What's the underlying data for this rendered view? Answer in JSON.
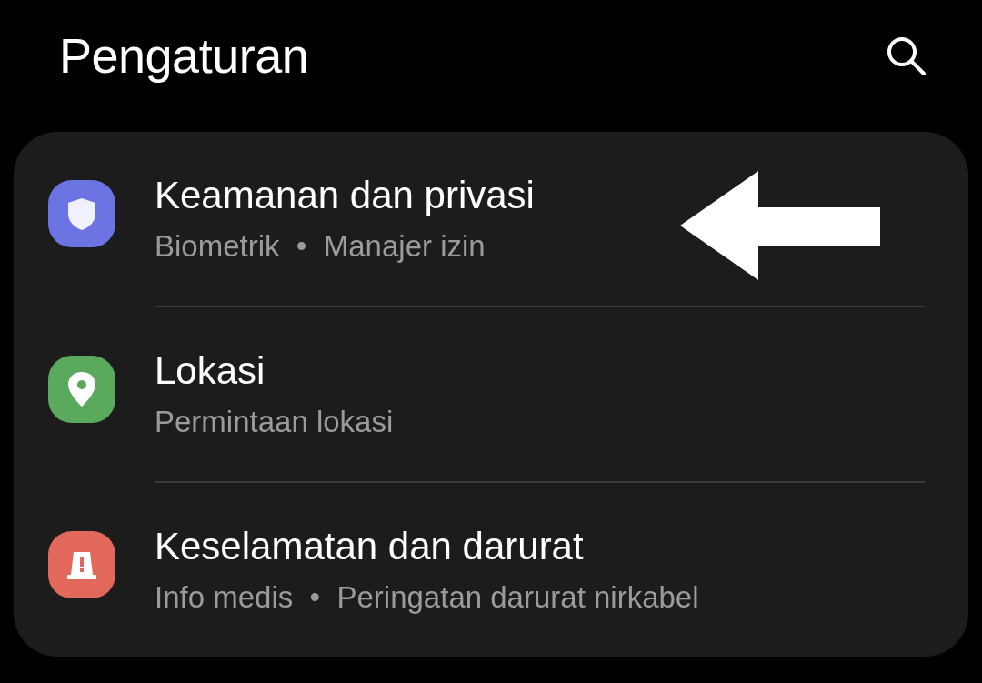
{
  "header": {
    "title": "Pengaturan"
  },
  "items": [
    {
      "title": "Keamanan dan privasi",
      "subtitle": "Biometrik  •  Manajer izin",
      "kind": "shield",
      "color": "#6c73e3"
    },
    {
      "title": "Lokasi",
      "subtitle": "Permintaan lokasi",
      "kind": "pin",
      "color": "#5aa95c"
    },
    {
      "title": "Keselamatan dan darurat",
      "subtitle": "Info medis  •  Peringatan darurat nirkabel",
      "kind": "alert",
      "color": "#e2685c"
    }
  ]
}
